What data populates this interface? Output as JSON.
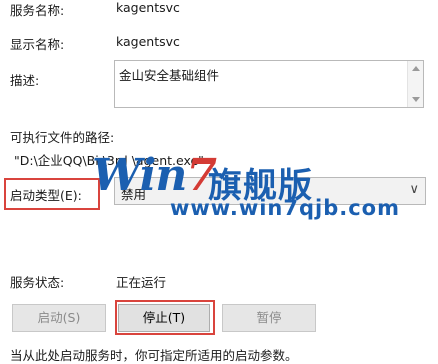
{
  "fields": {
    "service_name_label": "服务名称:",
    "service_name_value": "kagentsvc",
    "display_name_label": "显示名称:",
    "display_name_value": "kagentsvc",
    "description_label": "描述:",
    "description_value": "金山安全基础组件",
    "path_label": "可执行文件的路径:",
    "path_value": "\"D:\\企业QQ\\Bi  \\3rd  \\agent.exe\"",
    "startup_type_label": "启动类型(E):",
    "startup_type_value": "禁用",
    "status_label": "服务状态:",
    "status_value": "正在运行"
  },
  "buttons": {
    "start": "启动(S)",
    "stop": "停止(T)",
    "pause": "暂停"
  },
  "hint_text": "当从此处启动服务时，你可指定所适用的启动参数。",
  "watermark": {
    "logo_win": "Win",
    "logo_seven": "7",
    "logo_cn": "旗舰版",
    "url": "www.win7qjb.com"
  },
  "colors": {
    "highlight": "#d9443d",
    "watermark_blue": "#1b5fb0"
  }
}
